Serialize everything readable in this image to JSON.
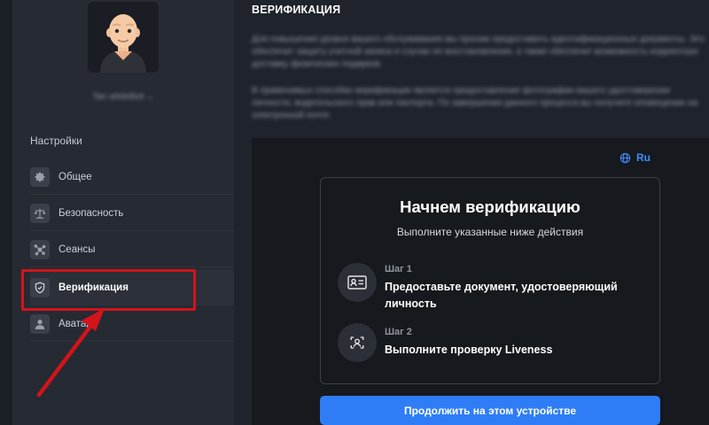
{
  "user": {
    "name": "Tan whitelbot"
  },
  "sidebar": {
    "section_title": "Настройки",
    "items": [
      {
        "label": "Общее",
        "icon": "gear-icon"
      },
      {
        "label": "Безопасность",
        "icon": "scales-icon"
      },
      {
        "label": "Сеансы",
        "icon": "network-icon"
      },
      {
        "label": "Верификация",
        "icon": "shield-check-icon",
        "active": true
      },
      {
        "label": "Аватар",
        "icon": "person-icon"
      }
    ]
  },
  "main": {
    "title": "ВЕРИФИКАЦИЯ",
    "paragraphs": [
      "Для повышения уровня вашего обслуживания мы просим предоставить идентификационные документы. Это обеспечит защиту учетной записи и случае ее восстановления, а также обеспечит возможность корректную доставку физических подарков.",
      "В применимых способах верификации является предоставление фотографии вашего удостоверения личности, водительского прав или паспорта. По завершении данного процесса вы получите оповещение на электронной почте."
    ]
  },
  "verification": {
    "language": "Ru",
    "heading": "Начнем верификацию",
    "subheading": "Выполните указанные ниже действия",
    "steps": [
      {
        "label": "Шаг 1",
        "text": "Предоставьте документ, удостоверяющий личность",
        "icon": "id-card-icon"
      },
      {
        "label": "Шаг 2",
        "text": "Выполните проверку Liveness",
        "icon": "face-scan-icon"
      }
    ],
    "button_label": "Продолжить на этом устройстве"
  },
  "colors": {
    "accent": "#2f7df6",
    "annotation": "#d2141b",
    "background": "#1f232b",
    "panel": "#16191e"
  }
}
